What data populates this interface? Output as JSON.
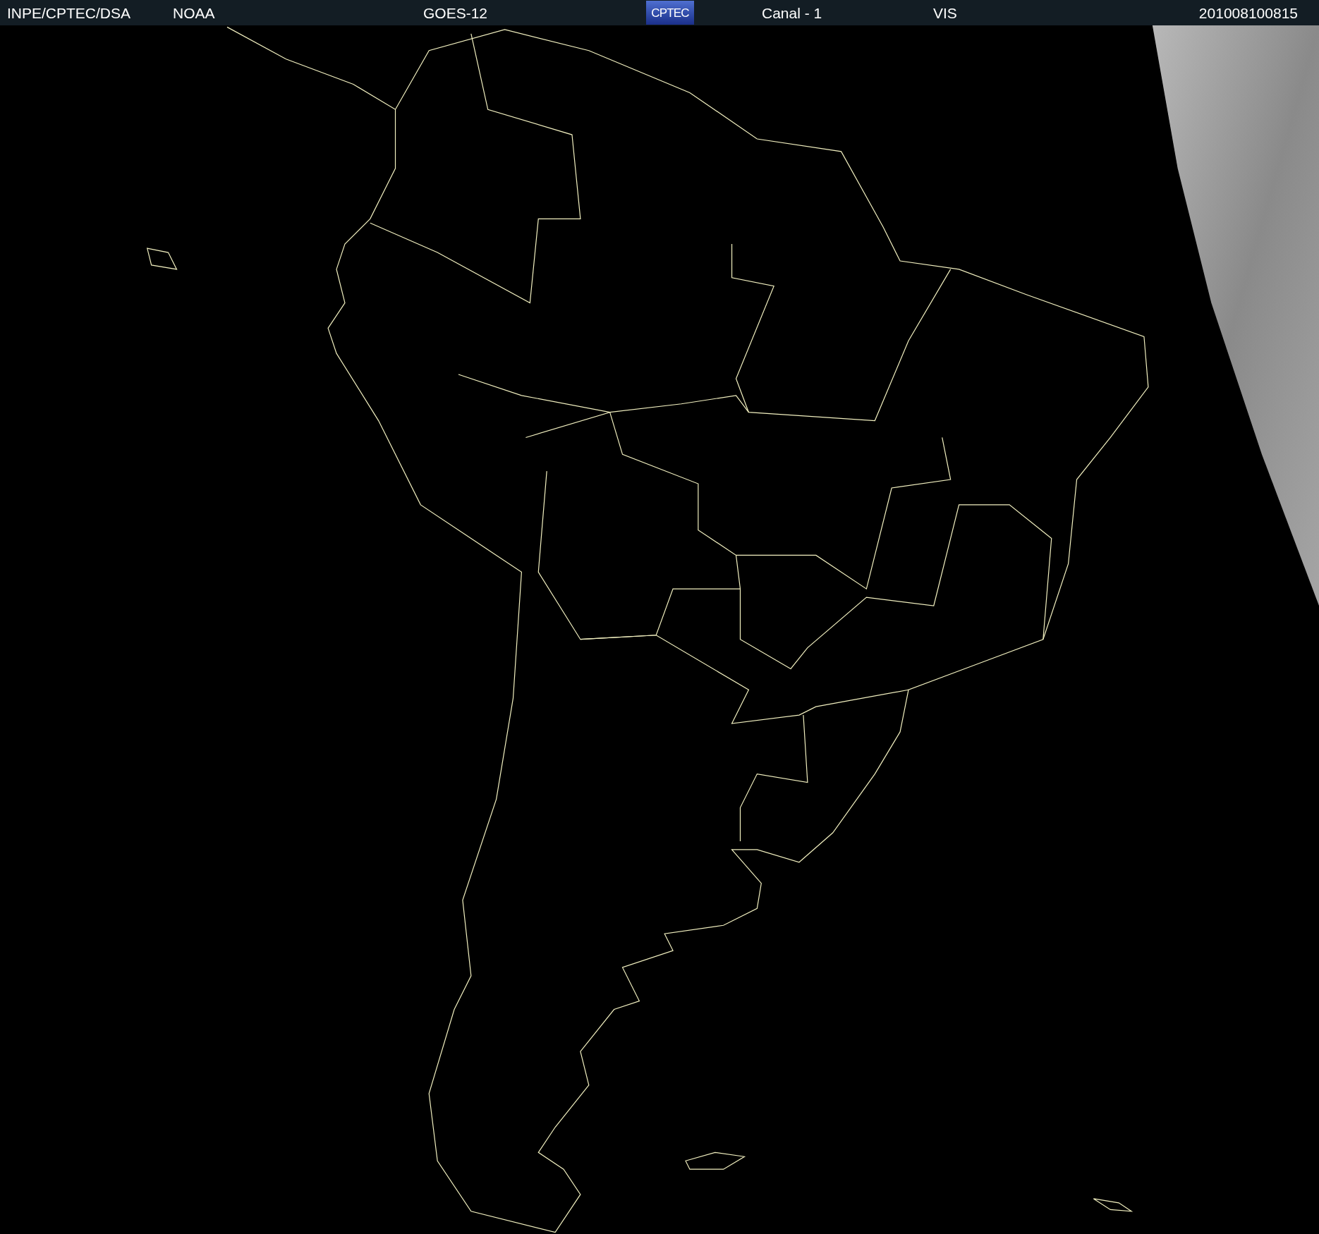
{
  "header": {
    "source": "INPE/CPTEC/DSA",
    "agency": "NOAA",
    "satellite": "GOES-12",
    "logo": "CPTEC",
    "channel": "Canal - 1",
    "band": "VIS",
    "timestamp": "201008100815"
  }
}
